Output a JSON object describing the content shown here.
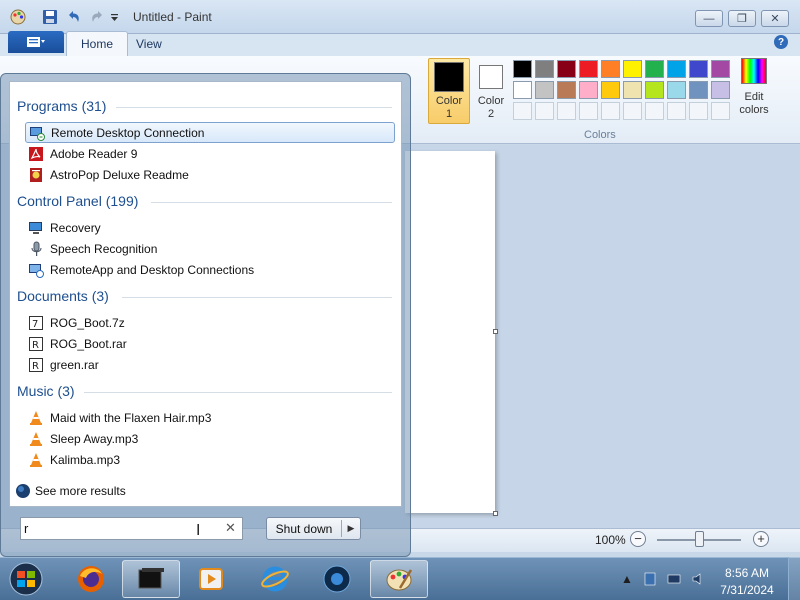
{
  "window": {
    "title": "Untitled - Paint",
    "controls": {
      "minimize": "—",
      "maximize": "❐",
      "close": "✕"
    }
  },
  "ribbon": {
    "tabs": [
      {
        "label": "Home",
        "active": true
      },
      {
        "label": "View",
        "active": false
      }
    ],
    "help": "?",
    "colors": {
      "color1": {
        "label": "Color 1",
        "value": "#000000"
      },
      "color2": {
        "label": "Color 2",
        "value": "#ffffff"
      },
      "palette_row1": [
        "#000000",
        "#7f7f7f",
        "#880015",
        "#ed1c24",
        "#ff7f27",
        "#fff200",
        "#22b14c",
        "#00a2e8",
        "#3f48cc",
        "#a349a4"
      ],
      "palette_row2": [
        "#ffffff",
        "#c3c3c3",
        "#b97a57",
        "#ffaec9",
        "#ffc90e",
        "#efe4b0",
        "#b5e61d",
        "#99d9ea",
        "#7092be",
        "#c8bfe7"
      ],
      "edit_label": "Edit colors",
      "group_label": "Colors"
    }
  },
  "status": {
    "zoom": "100%",
    "zoom_out": "−",
    "zoom_in": "+",
    "zoom_level": 0.5
  },
  "start_menu": {
    "groups": [
      {
        "title": "Programs (31)",
        "items": [
          {
            "label": "Remote Desktop Connection",
            "icon": "remote-desktop-icon",
            "highlighted": true
          },
          {
            "label": "Adobe Reader 9",
            "icon": "adobe-reader-icon"
          },
          {
            "label": "AstroPop Deluxe Readme",
            "icon": "readme-icon"
          }
        ]
      },
      {
        "title": "Control Panel (199)",
        "items": [
          {
            "label": "Recovery",
            "icon": "recovery-icon"
          },
          {
            "label": "Speech Recognition",
            "icon": "microphone-icon"
          },
          {
            "label": "RemoteApp and Desktop Connections",
            "icon": "remoteapp-icon"
          }
        ]
      },
      {
        "title": "Documents (3)",
        "items": [
          {
            "label": "ROG_Boot.7z",
            "icon": "archive-icon"
          },
          {
            "label": "ROG_Boot.rar",
            "icon": "archive-icon"
          },
          {
            "label": "green.rar",
            "icon": "archive-icon"
          }
        ]
      },
      {
        "title": "Music (3)",
        "items": [
          {
            "label": "Maid with the Flaxen Hair.mp3",
            "icon": "vlc-icon"
          },
          {
            "label": "Sleep Away.mp3",
            "icon": "vlc-icon"
          },
          {
            "label": "Kalimba.mp3",
            "icon": "vlc-icon"
          }
        ]
      }
    ],
    "see_more": "See more results",
    "search_value": "r",
    "clear": "✕",
    "shutdown_label": "Shut down"
  },
  "taskbar": {
    "time": "8:56 AM",
    "date": "7/31/2024",
    "tray_arrow": "▲"
  }
}
